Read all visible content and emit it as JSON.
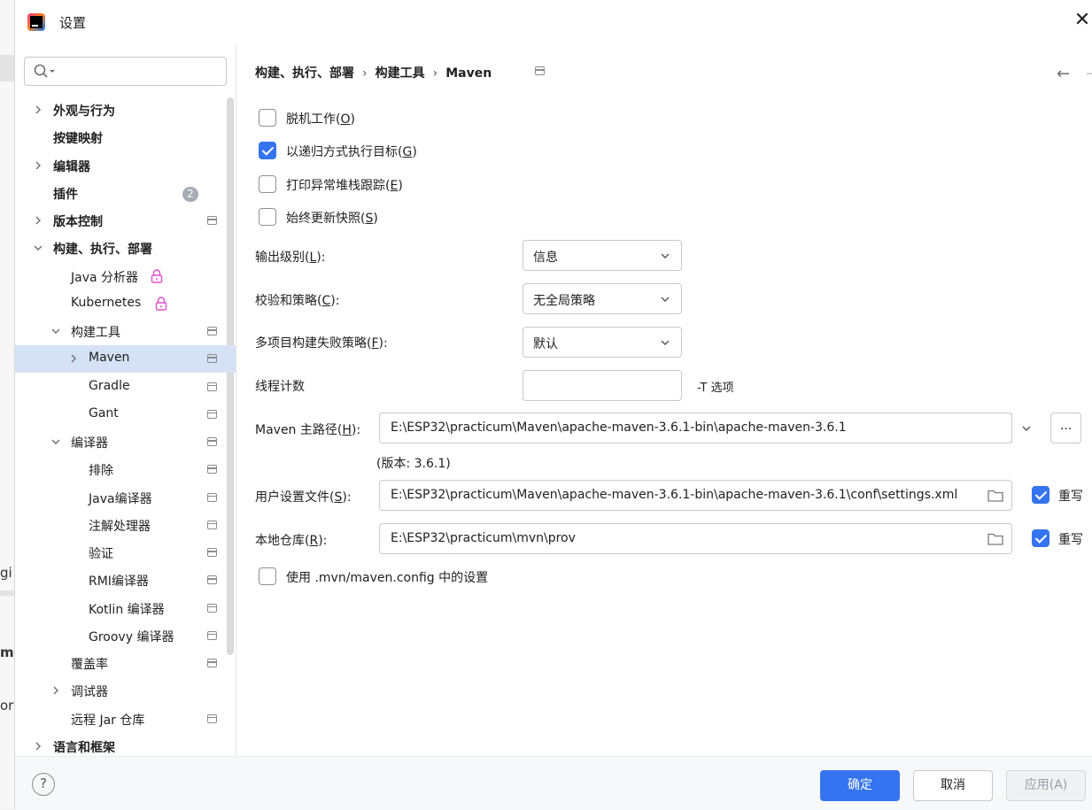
{
  "dialog": {
    "title": "设置"
  },
  "background_fragments": [
    "gi",
    "m",
    "or"
  ],
  "search": {
    "placeholder": ""
  },
  "sidebar": {
    "items": [
      {
        "label": "外观与行为",
        "bold": true,
        "level": 0,
        "chevron": "right"
      },
      {
        "label": "按键映射",
        "bold": true,
        "level": 0
      },
      {
        "label": "编辑器",
        "bold": true,
        "level": 0,
        "chevron": "right"
      },
      {
        "label": "插件",
        "bold": true,
        "level": 0,
        "badge": "2"
      },
      {
        "label": "版本控制",
        "bold": true,
        "level": 0,
        "chevron": "right",
        "pin": true
      },
      {
        "label": "构建、执行、部署",
        "bold": true,
        "level": 0,
        "chevron": "down"
      },
      {
        "label": "Java 分析器",
        "level": 1,
        "lock": true
      },
      {
        "label": "Kubernetes",
        "level": 1,
        "lock": true
      },
      {
        "label": "构建工具",
        "level": 1,
        "chevron": "down",
        "pin": true
      },
      {
        "label": "Maven",
        "level": 2,
        "chevron": "right",
        "pin": true,
        "selected": true
      },
      {
        "label": "Gradle",
        "level": 2,
        "pin": true
      },
      {
        "label": "Gant",
        "level": 2,
        "pin": true
      },
      {
        "label": "编译器",
        "level": 1,
        "chevron": "down",
        "pin": true
      },
      {
        "label": "排除",
        "level": 2,
        "pin": true
      },
      {
        "label": "Java编译器",
        "level": 2,
        "pin": true
      },
      {
        "label": "注解处理器",
        "level": 2,
        "pin": true
      },
      {
        "label": "验证",
        "level": 2,
        "pin": true
      },
      {
        "label": "RMI编译器",
        "level": 2,
        "pin": true
      },
      {
        "label": "Kotlin 编译器",
        "level": 2,
        "pin": true
      },
      {
        "label": "Groovy 编译器",
        "level": 2,
        "pin": true
      },
      {
        "label": "覆盖率",
        "level": 1,
        "pin": true
      },
      {
        "label": "调试器",
        "level": 1,
        "chevron": "right"
      },
      {
        "label": "远程 Jar 仓库",
        "level": 1,
        "pin": true
      },
      {
        "label": "语言和框架",
        "bold": true,
        "level": 0,
        "chevron": "right"
      }
    ]
  },
  "breadcrumb": {
    "part1": "构建、执行、部署",
    "sep": "›",
    "part2": "构建工具",
    "part3": "Maven"
  },
  "nav": {
    "back": "←",
    "forward": "→"
  },
  "options": {
    "offline": {
      "text": "脱机工作(",
      "key": "O",
      "end": ")",
      "checked": false
    },
    "recursive": {
      "text": "以递归方式执行目标(",
      "key": "G",
      "end": ")",
      "checked": true
    },
    "stacktrace": {
      "text": "打印异常堆栈跟踪(",
      "key": "E",
      "end": ")",
      "checked": false
    },
    "snapshots": {
      "text": "始终更新快照(",
      "key": "S",
      "end": ")",
      "checked": false
    },
    "mvn_config": {
      "text": "使用 .mvn/maven.config 中的设置",
      "checked": false
    }
  },
  "output_level": {
    "text": "输出级别(",
    "key": "L",
    "end": "):",
    "value": "信息"
  },
  "checksum": {
    "text": "校验和策略(",
    "key": "C",
    "end": "):",
    "value": "无全局策略"
  },
  "multiproject": {
    "text": "多项目构建失败策略(",
    "key": "F",
    "end": "):",
    "value": "默认"
  },
  "threads": {
    "label": "线程计数",
    "value": "",
    "hint": "-T 选项"
  },
  "maven_home": {
    "text": "Maven 主路径(",
    "key": "H",
    "end": "):",
    "value": "E:\\ESP32\\practicum\\Maven\\apache-maven-3.6.1-bin\\apache-maven-3.6.1",
    "browse": "...",
    "version": "(版本: 3.6.1)"
  },
  "user_settings": {
    "text": "用户设置文件(",
    "key": "S",
    "end": "):",
    "value": "E:\\ESP32\\practicum\\Maven\\apache-maven-3.6.1-bin\\apache-maven-3.6.1\\conf\\settings.xml",
    "override": "重写",
    "override_checked": true
  },
  "local_repo": {
    "text": "本地仓库(",
    "key": "R",
    "end": "):",
    "value": "E:\\ESP32\\practicum\\mvn\\prov",
    "override": "重写",
    "override_checked": true
  },
  "footer": {
    "help": "?",
    "ok": "确定",
    "cancel": "取消",
    "apply": "应用(A)"
  },
  "colors": {
    "accent": "#3574f0",
    "selection": "#d5e1f5",
    "badge": "#a7abb3",
    "lock": "#e04ec8"
  }
}
